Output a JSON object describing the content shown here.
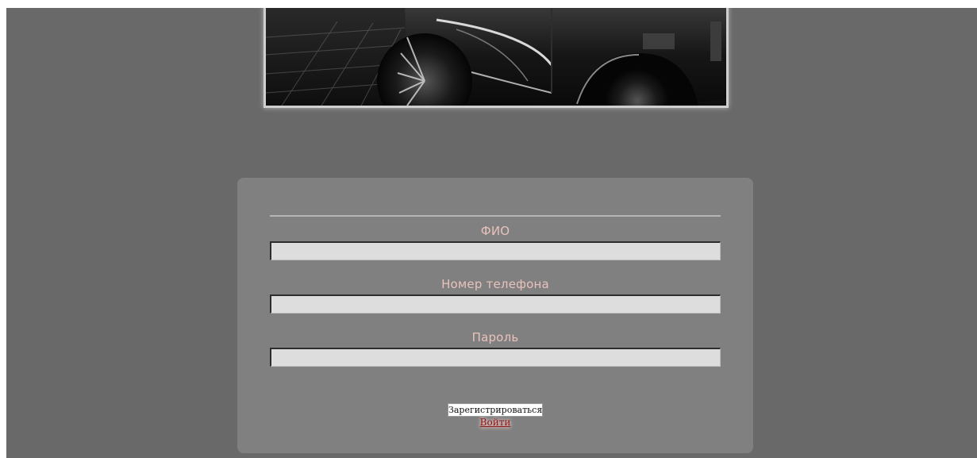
{
  "form": {
    "fields": [
      {
        "label": "ФИО",
        "value": ""
      },
      {
        "label": "Номер телефона",
        "value": ""
      },
      {
        "label": "Пароль",
        "value": ""
      }
    ],
    "submit_label": "Зарегистрироваться",
    "login_link_label": "Войти"
  },
  "colors": {
    "page_background": "#696969",
    "form_background": "#808080",
    "label_color": "#e9c2bd",
    "input_background": "#dddddd",
    "link_color": "#8a1414"
  },
  "icons": {
    "banner": "car-photo"
  }
}
